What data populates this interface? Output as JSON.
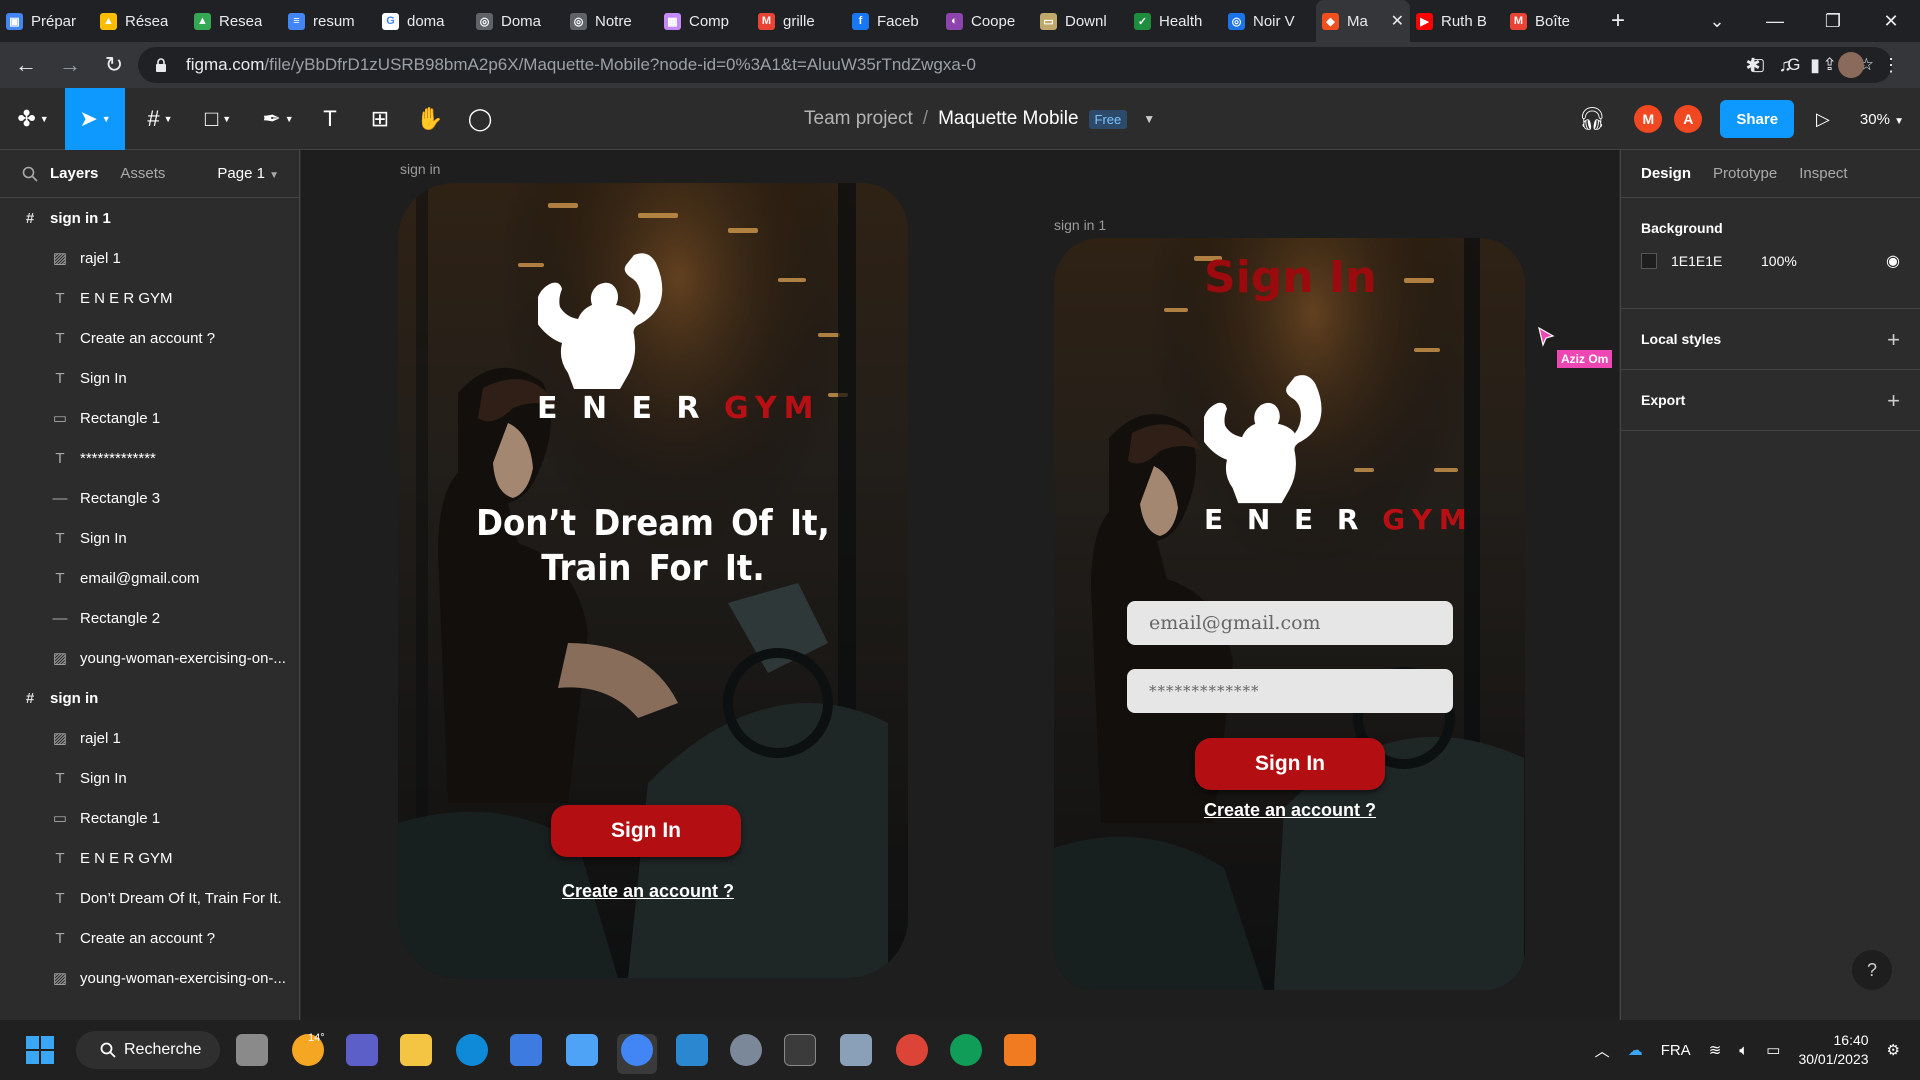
{
  "browser": {
    "tabs": [
      {
        "title": "Prépar",
        "color": "#4285f4",
        "glyph": "▣"
      },
      {
        "title": "Résea",
        "color": "#fbbc04",
        "glyph": "▲"
      },
      {
        "title": "Resea",
        "color": "#34a853",
        "glyph": "▲"
      },
      {
        "title": "resum",
        "color": "#4285f4",
        "glyph": "≡"
      },
      {
        "title": "doma",
        "color": "#ffffff",
        "glyph": "G"
      },
      {
        "title": "Doma",
        "color": "#5f6368",
        "glyph": "◎"
      },
      {
        "title": "Notre",
        "color": "#5f6368",
        "glyph": "◎"
      },
      {
        "title": "Comp",
        "color": "#c58af9",
        "glyph": "▦"
      },
      {
        "title": "grille",
        "color": "#ea4335",
        "glyph": "M"
      },
      {
        "title": "Faceb",
        "color": "#1877f2",
        "glyph": "f"
      },
      {
        "title": "Coope",
        "color": "#8e44ad",
        "glyph": "◐"
      },
      {
        "title": "Downl",
        "color": "#bfa86a",
        "glyph": "▭"
      },
      {
        "title": "Health",
        "color": "#1e8e3e",
        "glyph": "✓"
      },
      {
        "title": "Noir V",
        "color": "#1a73e8",
        "glyph": "◎"
      },
      {
        "title": "Ma",
        "color": "#f24e1e",
        "glyph": "◆",
        "active": true
      },
      {
        "title": "Ruth B",
        "color": "#ff0000",
        "glyph": "▶"
      },
      {
        "title": "Boîte",
        "color": "#ea4335",
        "glyph": "M"
      }
    ],
    "url_host": "figma.com",
    "url_path": "/file/yBbDfrD1zUSRB98bmA2p6X/Maquette-Mobile?node-id=0%3A1&t=AluuW35rTndZwgxa-0"
  },
  "figma": {
    "project": "Team project",
    "file": "Maquette Mobile",
    "plan_badge": "Free",
    "avatars": [
      {
        "initial": "M",
        "color": "#f24822"
      },
      {
        "initial": "A",
        "color": "#f24822"
      }
    ],
    "share_label": "Share",
    "zoom": "30%"
  },
  "left_panel": {
    "tabs": [
      "Layers",
      "Assets"
    ],
    "page": "Page 1",
    "layers": [
      {
        "name": "sign in 1",
        "type": "frame"
      },
      {
        "name": "rajel 1",
        "type": "image"
      },
      {
        "name": "E N E R GYM",
        "type": "text"
      },
      {
        "name": "Create an account ?",
        "type": "text"
      },
      {
        "name": "Sign In",
        "type": "text"
      },
      {
        "name": "Rectangle 1",
        "type": "rect"
      },
      {
        "name": "*************",
        "type": "text"
      },
      {
        "name": "Rectangle 3",
        "type": "line"
      },
      {
        "name": "Sign In",
        "type": "text"
      },
      {
        "name": "email@gmail.com",
        "type": "text"
      },
      {
        "name": "Rectangle 2",
        "type": "line"
      },
      {
        "name": "young-woman-exercising-on-...",
        "type": "image"
      },
      {
        "name": "sign in",
        "type": "frame"
      },
      {
        "name": "rajel 1",
        "type": "image"
      },
      {
        "name": "Sign In",
        "type": "text"
      },
      {
        "name": "Rectangle 1",
        "type": "rect"
      },
      {
        "name": "E N E R GYM",
        "type": "text"
      },
      {
        "name": "Don’t Dream Of It, Train For It.",
        "type": "text"
      },
      {
        "name": "Create an account ?",
        "type": "text"
      },
      {
        "name": "young-woman-exercising-on-...",
        "type": "image"
      }
    ]
  },
  "canvas": {
    "frame1": {
      "label": "sign in",
      "brand_a": "E N E R ",
      "brand_b": "GYM",
      "tagline_line1": "Don’t Dream Of It,",
      "tagline_line2": "Train For It.",
      "button": "Sign In",
      "link": "Create an account ?"
    },
    "frame2": {
      "label": "sign in 1",
      "title": "Sign In",
      "brand_a": "E N E R ",
      "brand_b": "GYM",
      "email_placeholder": "email@gmail.com",
      "password_mask": "*************",
      "button": "Sign In",
      "link": "Create an account ?"
    },
    "collaborator_cursor": "Aziz Om"
  },
  "right_panel": {
    "tabs": [
      "Design",
      "Prototype",
      "Inspect"
    ],
    "background_title": "Background",
    "background_hex": "1E1E1E",
    "background_opacity": "100%",
    "local_styles": "Local styles",
    "export": "Export",
    "help": "?"
  },
  "taskbar": {
    "search_label": "Recherche",
    "weather": "14°",
    "language": "FRA",
    "time": "16:40",
    "date": "30/01/2023"
  }
}
